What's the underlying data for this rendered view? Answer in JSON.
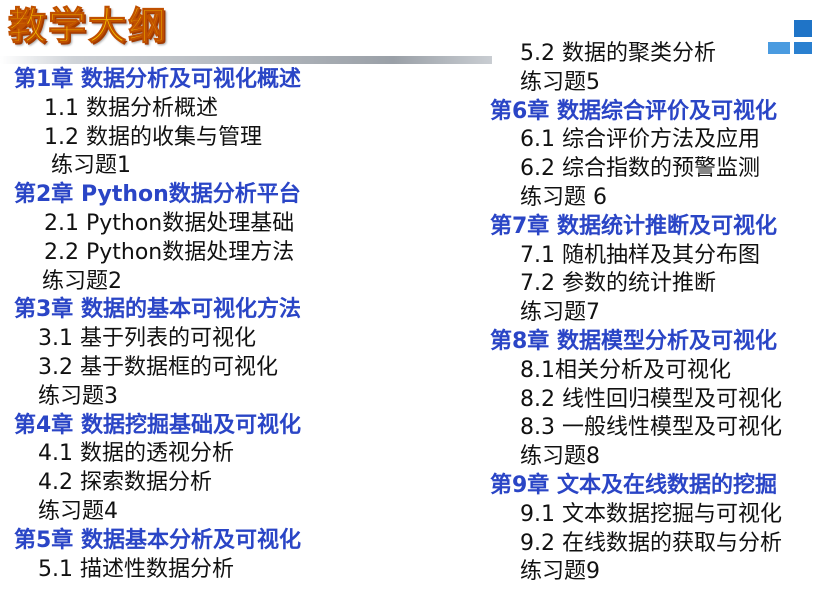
{
  "title": "教学大纲",
  "left_column": [
    {
      "text": "第1章  数据分析及可视化概述",
      "kind": "chapter"
    },
    {
      "text": "1.1 数据分析概述",
      "kind": "i1"
    },
    {
      "text": "1.2 数据的收集与管理",
      "kind": "i1"
    },
    {
      "text": "练习题1",
      "kind": "i3"
    },
    {
      "text": "第2章  Python数据分析平台",
      "kind": "chapter"
    },
    {
      "text": "2.1 Python数据处理基础",
      "kind": "i1"
    },
    {
      "text": "2.2 Python数据处理方法",
      "kind": "i1"
    },
    {
      "text": "练习题2",
      "kind": "i4"
    },
    {
      "text": "第3章  数据的基本可视化方法",
      "kind": "chapter"
    },
    {
      "text": "3.1 基于列表的可视化",
      "kind": "i2"
    },
    {
      "text": "3.2 基于数据框的可视化",
      "kind": "i2"
    },
    {
      "text": "练习题3",
      "kind": "i2"
    },
    {
      "text": "第4章  数据挖掘基础及可视化",
      "kind": "chapter"
    },
    {
      "text": "4.1 数据的透视分析",
      "kind": "i2"
    },
    {
      "text": "4.2 探索数据分析",
      "kind": "i2"
    },
    {
      "text": "练习题4",
      "kind": "i2"
    },
    {
      "text": "第5章  数据基本分析及可视化",
      "kind": "chapter"
    },
    {
      "text": "5.1 描述性数据分析",
      "kind": "i2"
    }
  ],
  "right_column": [
    {
      "text": "5.2 数据的聚类分析",
      "kind": "i1"
    },
    {
      "text": "练习题5",
      "kind": "i1"
    },
    {
      "text": "第6章  数据综合评价及可视化",
      "kind": "chapter"
    },
    {
      "text": "6.1 综合评价方法及应用",
      "kind": "i1"
    },
    {
      "text": "6.2 综合指数的预警监测",
      "kind": "i1"
    },
    {
      "text": "练习题 6",
      "kind": "i1"
    },
    {
      "text": "第7章  数据统计推断及可视化",
      "kind": "chapter"
    },
    {
      "text": "7.1 随机抽样及其分布图",
      "kind": "i1"
    },
    {
      "text": "7.2 参数的统计推断",
      "kind": "i1"
    },
    {
      "text": "练习题7",
      "kind": "i1"
    },
    {
      "text": "第8章  数据模型分析及可视化",
      "kind": "chapter"
    },
    {
      "text": "8.1相关分析及可视化",
      "kind": "i1"
    },
    {
      "text": "8.2 线性回归模型及可视化",
      "kind": "i1"
    },
    {
      "text": "8.3 一般线性模型及可视化",
      "kind": "i1"
    },
    {
      "text": "练习题8",
      "kind": "i1"
    },
    {
      "text": "第9章  文本及在线数据的挖掘",
      "kind": "chapter"
    },
    {
      "text": "9.1 文本数据挖掘与可视化",
      "kind": "i1"
    },
    {
      "text": "9.2 在线数据的获取与分析",
      "kind": "i1"
    },
    {
      "text": "练习题9",
      "kind": "i1"
    }
  ],
  "colors": {
    "chapter": "#2a45c6",
    "body_text": "#111111",
    "title_fill": "#f5c400",
    "accent_blue": "#1f74c7"
  }
}
